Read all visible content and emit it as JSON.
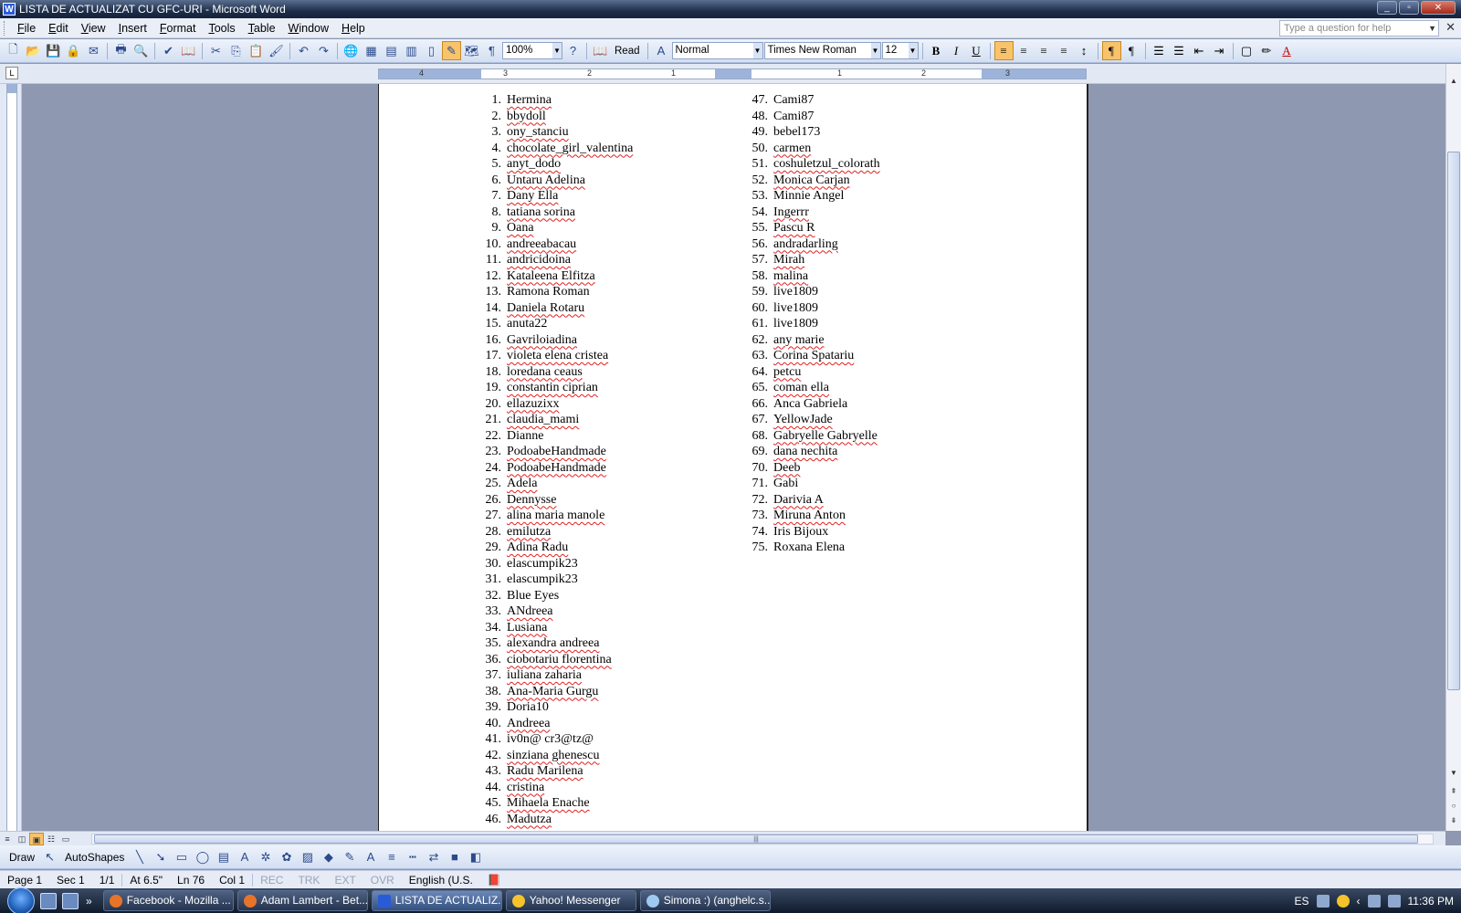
{
  "window": {
    "title": "LISTA DE ACTUALIZAT CU GFC-URI - Microsoft Word"
  },
  "menu": [
    "File",
    "Edit",
    "View",
    "Insert",
    "Format",
    "Tools",
    "Table",
    "Window",
    "Help"
  ],
  "help_placeholder": "Type a question for help",
  "toolbar": {
    "zoom": "100%",
    "read_label": "Read",
    "style": "Normal",
    "font": "Times New Roman",
    "size": "12"
  },
  "ruler_numbers": [
    "4",
    "3",
    "2",
    "1",
    "1",
    "2",
    "3"
  ],
  "list_left": [
    {
      "n": "1.",
      "t": "Hermina",
      "sq": true
    },
    {
      "n": "2.",
      "t": "bbydoll",
      "sq": true
    },
    {
      "n": "3.",
      "t": "ony_stanciu",
      "sq": true
    },
    {
      "n": "4.",
      "t": "chocolate_girl_valentina",
      "sq": true
    },
    {
      "n": "5.",
      "t": "anyt_dodo",
      "sq": true
    },
    {
      "n": "6.",
      "t": "Untaru Adelina",
      "sq": true
    },
    {
      "n": "7.",
      "t": "Dany Ella",
      "sq": true
    },
    {
      "n": "8.",
      "t": "tatiana sorina",
      "sq": true
    },
    {
      "n": "9.",
      "t": "Oana",
      "sq": true
    },
    {
      "n": "10.",
      "t": "andreeabacau",
      "sq": true
    },
    {
      "n": "11.",
      "t": "andricidoina",
      "sq": true
    },
    {
      "n": "12.",
      "t": "Kataleena Elfitza",
      "sq": true
    },
    {
      "n": "13.",
      "t": "Ramona Roman",
      "sq": false
    },
    {
      "n": "14.",
      "t": "Daniela Rotaru",
      "sq": true
    },
    {
      "n": "15.",
      "t": "anuta22",
      "sq": false
    },
    {
      "n": "16.",
      "t": "Gavriloiadina",
      "sq": true
    },
    {
      "n": "17.",
      "t": "violeta elena cristea",
      "sq": true
    },
    {
      "n": "18.",
      "t": "loredana ceaus",
      "sq": true
    },
    {
      "n": "19.",
      "t": "constantin ciprian",
      "sq": true
    },
    {
      "n": "20.",
      "t": "ellazuzixx",
      "sq": true
    },
    {
      "n": "21.",
      "t": "claudia_mami",
      "sq": true
    },
    {
      "n": "22.",
      "t": "Dianne",
      "sq": false
    },
    {
      "n": "23.",
      "t": "PodoabeHandmade",
      "sq": true
    },
    {
      "n": "24.",
      "t": "PodoabeHandmade",
      "sq": true
    },
    {
      "n": "25.",
      "t": "Adela",
      "sq": true
    },
    {
      "n": "26.",
      "t": "Dennysse",
      "sq": true
    },
    {
      "n": "27.",
      "t": "alina maria manole",
      "sq": true
    },
    {
      "n": "28.",
      "t": "emilutza",
      "sq": true
    },
    {
      "n": "29.",
      "t": "Adina Radu",
      "sq": true
    },
    {
      "n": "30.",
      "t": "elascumpik23",
      "sq": false
    },
    {
      "n": "31.",
      "t": "elascumpik23",
      "sq": false
    },
    {
      "n": "32.",
      "t": "Blue Eyes",
      "sq": false
    },
    {
      "n": "33.",
      "t": "ANdreea",
      "sq": true
    },
    {
      "n": "34.",
      "t": "Lusiana",
      "sq": true
    },
    {
      "n": "35.",
      "t": "alexandra andreea",
      "sq": true
    },
    {
      "n": "36.",
      "t": "ciobotariu florentina",
      "sq": true
    },
    {
      "n": "37.",
      "t": "iuliana zaharia",
      "sq": true
    },
    {
      "n": "38.",
      "t": "Ana-Maria Gurgu",
      "sq": true
    },
    {
      "n": "39.",
      "t": "Doria10",
      "sq": false
    },
    {
      "n": "40.",
      "t": "Andreea",
      "sq": true
    },
    {
      "n": "41.",
      "t": "iv0n@ cr3@tz@",
      "sq": false
    },
    {
      "n": "42.",
      "t": "sinziana ghenescu",
      "sq": true
    },
    {
      "n": "43.",
      "t": "Radu Marilena",
      "sq": true
    },
    {
      "n": "44.",
      "t": "cristina",
      "sq": true
    },
    {
      "n": "45.",
      "t": "Mihaela Enache",
      "sq": true
    },
    {
      "n": "46.",
      "t": "Madutza",
      "sq": true
    }
  ],
  "list_right": [
    {
      "n": "47.",
      "t": "Cami87",
      "sq": false
    },
    {
      "n": "48.",
      "t": "Cami87",
      "sq": false
    },
    {
      "n": "49.",
      "t": "bebel173",
      "sq": false
    },
    {
      "n": "50.",
      "t": "carmen",
      "sq": true
    },
    {
      "n": "51.",
      "t": "coshuletzul_colorath",
      "sq": true
    },
    {
      "n": "52.",
      "t": "Monica Carjan",
      "sq": true
    },
    {
      "n": "53.",
      "t": "Minnie Angel",
      "sq": false
    },
    {
      "n": "54.",
      "t": "Ingerrr",
      "sq": true
    },
    {
      "n": "55.",
      "t": "Pascu R",
      "sq": true
    },
    {
      "n": "56.",
      "t": "andradarling",
      "sq": true
    },
    {
      "n": "57.",
      "t": "Mirah",
      "sq": true
    },
    {
      "n": "58.",
      "t": "malina",
      "sq": true
    },
    {
      "n": "59.",
      "t": "live1809",
      "sq": false
    },
    {
      "n": "60.",
      "t": "live1809",
      "sq": false
    },
    {
      "n": "61.",
      "t": "live1809",
      "sq": false
    },
    {
      "n": "62.",
      "t": "any marie",
      "sq": true
    },
    {
      "n": "63.",
      "t": "Corina Spatariu",
      "sq": true
    },
    {
      "n": "64.",
      "t": "petcu",
      "sq": true
    },
    {
      "n": "65.",
      "t": "coman ella",
      "sq": true
    },
    {
      "n": "66.",
      "t": "Anca Gabriela",
      "sq": false
    },
    {
      "n": "67.",
      "t": "YellowJade",
      "sq": true
    },
    {
      "n": "68.",
      "t": "Gabryelle Gabryelle",
      "sq": true
    },
    {
      "n": "69.",
      "t": "dana nechita",
      "sq": true
    },
    {
      "n": "70.",
      "t": "Deeb",
      "sq": true
    },
    {
      "n": "71.",
      "t": "Gabi",
      "sq": false
    },
    {
      "n": "72.",
      "t": "Darivia A",
      "sq": true
    },
    {
      "n": "73.",
      "t": "Miruna Anton",
      "sq": true
    },
    {
      "n": "74.",
      "t": "Iris Bijoux",
      "sq": false
    },
    {
      "n": "75.",
      "t": "Roxana Elena",
      "sq": false
    }
  ],
  "drawbar": {
    "draw": "Draw",
    "autoshapes": "AutoShapes"
  },
  "status": {
    "page": "Page 1",
    "sec": "Sec 1",
    "pages": "1/1",
    "at": "At 6.5\"",
    "ln": "Ln 76",
    "col": "Col 1",
    "rec": "REC",
    "trk": "TRK",
    "ext": "EXT",
    "ovr": "OVR",
    "lang": "English (U.S."
  },
  "taskbar": {
    "items": [
      {
        "label": "Facebook - Mozilla ...",
        "icon": "firefox-icon"
      },
      {
        "label": "Adam Lambert - Bet...",
        "icon": "firefox-icon"
      },
      {
        "label": "LISTA DE ACTUALIZ...",
        "icon": "word-icon"
      },
      {
        "label": "Yahoo! Messenger",
        "icon": "yahoo-messenger-icon"
      },
      {
        "label": "Simona :) (anghelc.s...",
        "icon": "chat-icon"
      }
    ],
    "lang": "ES",
    "clock": "11:36 PM"
  }
}
